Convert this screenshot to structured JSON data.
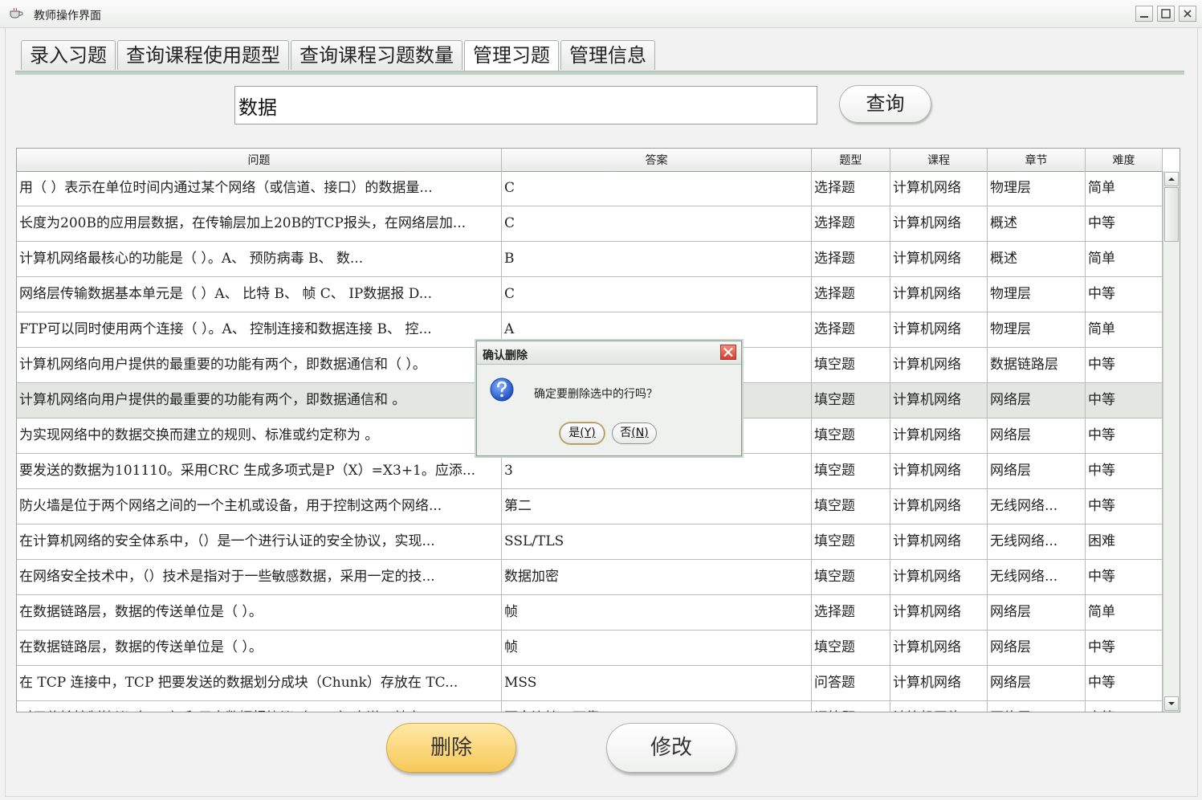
{
  "window": {
    "title": "教师操作界面"
  },
  "tabs": [
    {
      "label": "录入习题",
      "active": false
    },
    {
      "label": "查询课程使用题型",
      "active": false
    },
    {
      "label": "查询课程习题数量",
      "active": false
    },
    {
      "label": "管理习题",
      "active": true
    },
    {
      "label": "管理信息",
      "active": false
    }
  ],
  "search": {
    "value": "数据",
    "button_label": "查询"
  },
  "table": {
    "columns": [
      "问题",
      "答案",
      "题型",
      "课程",
      "章节",
      "难度"
    ],
    "rows": [
      [
        "用（ ）表示在单位时间内通过某个网络（或信道、接口）的数据量...",
        "C",
        "选择题",
        "计算机网络",
        "物理层",
        "简单"
      ],
      [
        "长度为200B的应用层数据，在传输层加上20B的TCP报头，在网络层加...",
        "C",
        "选择题",
        "计算机网络",
        "概述",
        "中等"
      ],
      [
        "计算机网络最核心的功能是（ ）。A、 预防病毒          B、 数...",
        "B",
        "选择题",
        "计算机网络",
        "概述",
        "简单"
      ],
      [
        "网络层传输数据基本单元是（ ）A、 比特 B、 帧 C、 IP数据报 D...",
        "C",
        "选择题",
        "计算机网络",
        "物理层",
        "中等"
      ],
      [
        "FTP可以同时使用两个连接（ ）。A、 控制连接和数据连接 B、 控...",
        "A",
        "选择题",
        "计算机网络",
        "物理层",
        "简单"
      ],
      [
        "计算机网络向用户提供的最重要的功能有两个，即数据通信和（ ）。",
        "",
        "填空题",
        "计算机网络",
        "数据链路层",
        "中等"
      ],
      [
        "计算机网络向用户提供的最重要的功能有两个，即数据通信和 。",
        "",
        "填空题",
        "计算机网络",
        "网络层",
        "中等"
      ],
      [
        "为实现网络中的数据交换而建立的规则、标准或约定称为 。",
        "",
        "填空题",
        "计算机网络",
        "网络层",
        "中等"
      ],
      [
        "要发送的数据为101110。采用CRC 生成多项式是P（X）=X3+1。应添...",
        "3",
        "填空题",
        "计算机网络",
        "网络层",
        "中等"
      ],
      [
        "防火墙是位于两个网络之间的一个主机或设备，用于控制这两个网络...",
        "第二",
        "填空题",
        "计算机网络",
        "无线网络...",
        "中等"
      ],
      [
        "在计算机网络的安全体系中，（）是一个进行认证的安全协议，实现...",
        "SSL/TLS",
        "填空题",
        "计算机网络",
        "无线网络...",
        "困难"
      ],
      [
        "在网络安全技术中，（）技术是指对于一些敏感数据，采用一定的技...",
        "数据加密",
        "填空题",
        "计算机网络",
        "无线网络...",
        "中等"
      ],
      [
        "在数据链路层，数据的传送单位是（ ）。",
        "帧",
        "选择题",
        "计算机网络",
        "网络层",
        "简单"
      ],
      [
        "在数据链路层，数据的传送单位是（ ）。",
        "帧",
        "填空题",
        "计算机网络",
        "网络层",
        "中等"
      ],
      [
        "在 TCP 连接中，TCP 把要发送的数据划分成块（Chunk）存放在 TC...",
        "MSS",
        "问答题",
        "计算机网络",
        "网络层",
        "中等"
      ],
      [
        "对于传输控制协议（TCP）和用户数据报协议（UDP）来说，其中 TCP...",
        "面向连接，可靠",
        "问答题",
        "计算机网络",
        "网络层",
        "中等"
      ]
    ],
    "selected_row": 6
  },
  "actions": {
    "delete_label": "删除",
    "edit_label": "修改"
  },
  "dialog": {
    "title": "确认删除",
    "message": "确定要删除选中的行吗？",
    "yes_label": "是",
    "yes_mnemonic": "(Y)",
    "no_label": "否",
    "no_mnemonic": "(N)"
  },
  "icons": {
    "dialog_icon": "question-icon",
    "close_icon": "close-icon"
  },
  "colors": {
    "delete_button": "#f7c85a",
    "selected_row": "#e4e6e4",
    "close_button": "#d4402e"
  }
}
